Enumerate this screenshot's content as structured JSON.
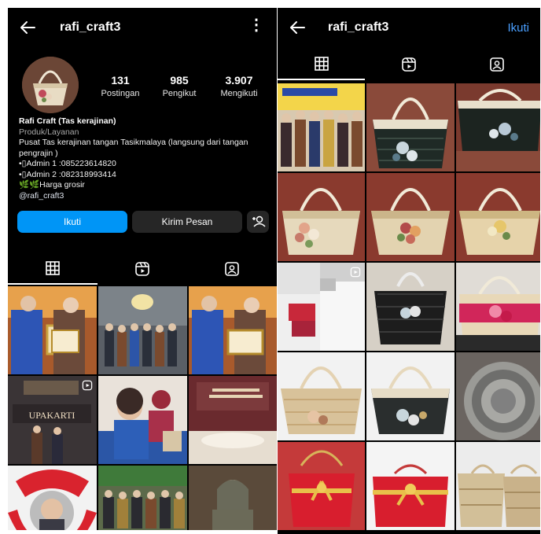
{
  "left": {
    "username": "rafi_craft3",
    "stats": [
      {
        "value": "131",
        "label": "Postingan"
      },
      {
        "value": "985",
        "label": "Pengikut"
      },
      {
        "value": "3.907",
        "label": "Mengikuti"
      }
    ],
    "bio": {
      "name": "Rafi Craft (Tas kerajinan)",
      "category": "Produk/Layanan",
      "lines": [
        "Pusat Tas kerajinan tangan Tasikmalaya (langsung dari tangan pengrajin )",
        "•▯Admin 1 :085223614820",
        "•▯Admin 2 :082318993414",
        "🌿🌿Harga grosir"
      ],
      "handle": "@rafi_craft3"
    },
    "buttons": {
      "follow": "Ikuti",
      "message": "Kirim Pesan"
    }
  },
  "right": {
    "username": "rafi_craft3",
    "follow": "Ikuti"
  },
  "colors": {
    "background": "#000000",
    "accent_blue": "#0095f6",
    "link_blue": "#4a9fff",
    "button_gray": "#262626"
  },
  "icons": [
    "back-arrow-icon",
    "more-vertical-icon",
    "grid-icon",
    "reels-icon",
    "tagged-icon",
    "add-person-icon"
  ]
}
